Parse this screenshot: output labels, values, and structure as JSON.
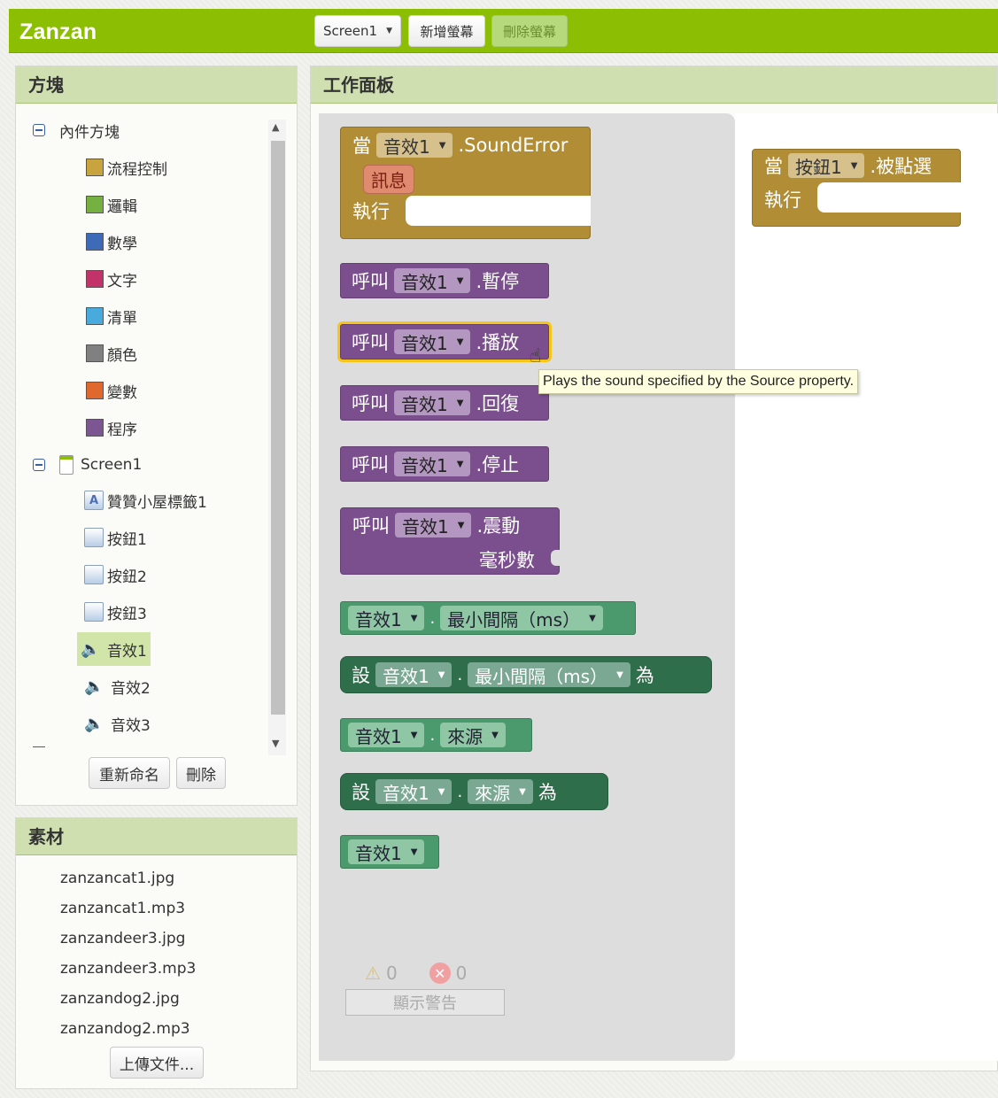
{
  "app": {
    "title": "Zanzan"
  },
  "toolbar": {
    "screen_select": "Screen1",
    "add_screen": "新增螢幕",
    "remove_screen": "刪除螢幕"
  },
  "blocks_panel": {
    "title": "方塊",
    "builtin_label": "內件方塊",
    "builtin": [
      {
        "label": "流程控制",
        "color": "#c8a43f"
      },
      {
        "label": "邏輯",
        "color": "#76b041"
      },
      {
        "label": "數學",
        "color": "#3e6bb8"
      },
      {
        "label": "文字",
        "color": "#c2336a"
      },
      {
        "label": "清單",
        "color": "#48aadd"
      },
      {
        "label": "顏色",
        "color": "#808080"
      },
      {
        "label": "變數",
        "color": "#e0682c"
      },
      {
        "label": "程序",
        "color": "#7b5690"
      }
    ],
    "screen_label": "Screen1",
    "components": [
      {
        "label": "贊贊小屋標籤1",
        "icon": "label-icon"
      },
      {
        "label": "按鈕1",
        "icon": "button-icon"
      },
      {
        "label": "按鈕2",
        "icon": "button-icon"
      },
      {
        "label": "按鈕3",
        "icon": "button-icon"
      },
      {
        "label": "音效1",
        "icon": "sound-icon",
        "selected": true
      },
      {
        "label": "音效2",
        "icon": "sound-icon"
      },
      {
        "label": "音效3",
        "icon": "sound-icon"
      }
    ],
    "rename_button": "重新命名",
    "delete_button": "刪除"
  },
  "assets_panel": {
    "title": "素材",
    "files": [
      "zanzancat1.jpg",
      "zanzancat1.mp3",
      "zanzandeer3.jpg",
      "zanzandeer3.mp3",
      "zanzandog2.jpg",
      "zanzandog2.mp3"
    ],
    "upload_button": "上傳文件..."
  },
  "workspace": {
    "title": "工作面板",
    "flyout_blocks": {
      "sound_error": {
        "when": "當",
        "component": "音效1",
        "event": ".SoundError",
        "param": "訊息",
        "do": "執行"
      },
      "call_pause": {
        "call": "呼叫",
        "component": "音效1",
        "method": ".暫停"
      },
      "call_play": {
        "call": "呼叫",
        "component": "音效1",
        "method": ".播放"
      },
      "call_resume": {
        "call": "呼叫",
        "component": "音效1",
        "method": ".回復"
      },
      "call_stop": {
        "call": "呼叫",
        "component": "音效1",
        "method": ".停止"
      },
      "call_vibrate": {
        "call": "呼叫",
        "component": "音效1",
        "method": ".震動",
        "arg": "毫秒數"
      },
      "get_min_interval": {
        "component": "音效1",
        "dot": ".",
        "property": "最小間隔（ms）"
      },
      "set_min_interval": {
        "set": "設",
        "component": "音效1",
        "dot": ".",
        "property": "最小間隔（ms）",
        "to": "為"
      },
      "get_source": {
        "component": "音效1",
        "dot": ".",
        "property": "來源"
      },
      "set_source": {
        "set": "設",
        "component": "音效1",
        "dot": ".",
        "property": "來源",
        "to": "為"
      },
      "component_ref": {
        "component": "音效1"
      }
    },
    "tooltip": "Plays the sound specified by the Source property.",
    "warnings": {
      "warning_count": "0",
      "error_count": "0",
      "show_button": "顯示警告"
    },
    "canvas_block": {
      "when": "當",
      "component": "按鈕1",
      "event": ".被點選",
      "do": "執行"
    }
  }
}
